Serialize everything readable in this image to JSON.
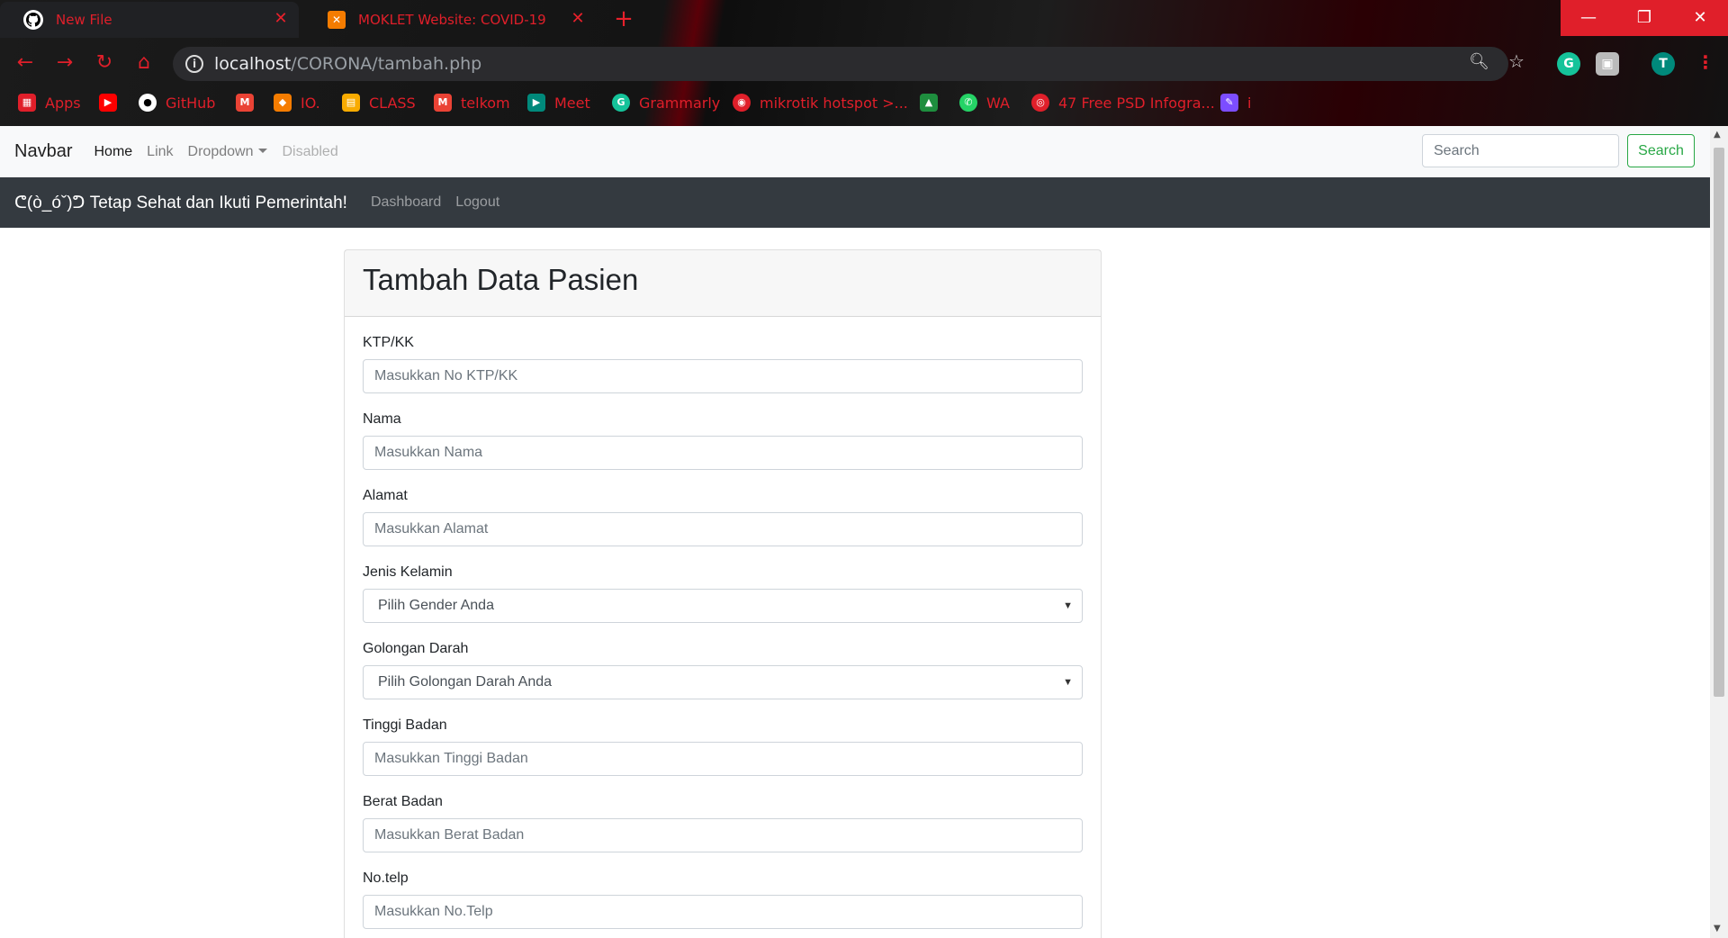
{
  "browser": {
    "tabs": [
      {
        "title": "New File",
        "icon": "github-icon"
      },
      {
        "title": "MOKLET Website: COVID-19",
        "icon": "xampp-icon"
      }
    ],
    "url_host": "localhost",
    "url_path": "/CORONA/tambah.php",
    "profile_initial": "T",
    "bookmarks": [
      {
        "label": "Apps",
        "icon": "apps-grid-icon",
        "color": "#e01f2a"
      },
      {
        "label": "",
        "icon": "youtube-icon",
        "color": "#ff0000"
      },
      {
        "label": "GitHub",
        "icon": "github-icon",
        "color": "#ffffff"
      },
      {
        "label": "",
        "icon": "gmail-icon",
        "color": "#ea4335"
      },
      {
        "label": "IO.",
        "icon": "io-icon",
        "color": "#f57c00"
      },
      {
        "label": "CLASS",
        "icon": "classroom-icon",
        "color": "#f9ab00"
      },
      {
        "label": "telkom",
        "icon": "gmail-icon",
        "color": "#ea4335"
      },
      {
        "label": "Meet",
        "icon": "meet-icon",
        "color": "#00897b"
      },
      {
        "label": "Grammarly",
        "icon": "grammarly-icon",
        "color": "#15c39a"
      },
      {
        "label": "mikrotik hotspot >...",
        "icon": "mikrotik-icon",
        "color": "#e01f2a"
      },
      {
        "label": "",
        "icon": "classroom-icon",
        "color": "#1e8e3e"
      },
      {
        "label": "WA",
        "icon": "whatsapp-icon",
        "color": "#25d366"
      },
      {
        "label": "47 Free PSD Infogra...",
        "icon": "psd-icon",
        "color": "#e01f2a"
      },
      {
        "label": "i",
        "icon": "feather-icon",
        "color": "#7c4dff"
      }
    ]
  },
  "navbar": {
    "brand": "Navbar",
    "links": [
      "Home",
      "Link",
      "Dropdown",
      "Disabled"
    ],
    "search_placeholder": "Search",
    "search_button": "Search"
  },
  "darkbar": {
    "brand": "ᕦ(ò_óˇ)ᕤ Tetap Sehat dan Ikuti Pemerintah!",
    "links": [
      "Dashboard",
      "Logout"
    ]
  },
  "form": {
    "title": "Tambah Data Pasien",
    "fields": [
      {
        "label": "KTP/KK",
        "placeholder": "Masukkan No KTP/KK"
      },
      {
        "label": "Nama",
        "placeholder": "Masukkan Nama"
      },
      {
        "label": "Alamat",
        "placeholder": "Masukkan Alamat"
      },
      {
        "label": "Jenis Kelamin",
        "value": "Pilih Gender Anda"
      },
      {
        "label": "Golongan Darah",
        "value": "Pilih Golongan Darah Anda"
      },
      {
        "label": "Tinggi Badan",
        "placeholder": "Masukkan Tinggi Badan"
      },
      {
        "label": "Berat Badan",
        "placeholder": "Masukkan Berat Badan"
      },
      {
        "label": "No.telp",
        "placeholder": "Masukkan No.Telp"
      }
    ]
  }
}
